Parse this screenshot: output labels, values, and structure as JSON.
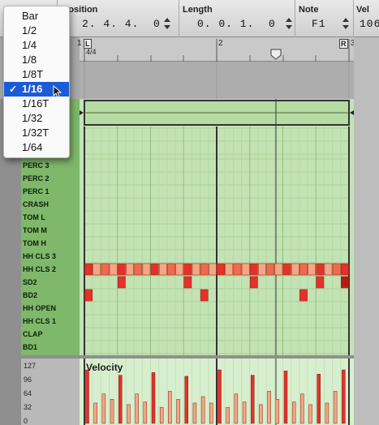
{
  "toolbar": {
    "position_label": "Position",
    "position_value": "2. 4. 4.  0",
    "length_label": "Length",
    "length_value": "0. 0. 1.  0",
    "note_label": "Note",
    "note_value": "F1",
    "vel_label": "Vel",
    "vel_value": "106"
  },
  "ruler": {
    "bar1": "1",
    "bar1_sig": "4/4",
    "bar2": "2",
    "bar3": "3",
    "loop_left_marker": "L",
    "loop_right_marker": "R"
  },
  "quantize_menu": {
    "items": [
      "Bar",
      "1/2",
      "1/4",
      "1/8",
      "1/8T",
      "1/16",
      "1/16T",
      "1/32",
      "1/32T",
      "1/64"
    ],
    "selected": "1/16",
    "check_glyph": "✓"
  },
  "drum_lanes": [
    "PERC 3",
    "PERC 2",
    "PERC 1",
    "CRASH",
    "TOM L",
    "TOM M",
    "TOM H",
    "HH CLS 3",
    "HH CLS 2",
    "SD2",
    "BD2",
    "HH OPEN",
    "HH CLS 1",
    "CLAP",
    "BD1"
  ],
  "velocity_lane": {
    "title": "Velocity",
    "ticks": [
      "127",
      "96",
      "64",
      "32",
      "0"
    ]
  },
  "colors": {
    "grid_bg": "#c3e3b4",
    "lane_label_bg": "#7fb86a",
    "note_strong": "#e5302b",
    "note_light": "#f5a685",
    "selection_blue": "#1c5bd8",
    "selected_note": "#b51a16"
  },
  "notes": {
    "hh_cls_2_steps": [
      {
        "v": 1.0
      },
      {
        "v": 0.5
      },
      {
        "v": 0.6
      },
      {
        "v": 0.5
      },
      {
        "v": 0.95
      },
      {
        "v": 0.5
      },
      {
        "v": 0.6
      },
      {
        "v": 0.5
      },
      {
        "v": 1.0
      },
      {
        "v": 0.5
      },
      {
        "v": 0.6
      },
      {
        "v": 0.5
      },
      {
        "v": 0.95
      },
      {
        "v": 0.5
      },
      {
        "v": 0.6
      },
      {
        "v": 0.5
      },
      {
        "v": 1.0
      },
      {
        "v": 0.5
      },
      {
        "v": 0.6
      },
      {
        "v": 0.5
      },
      {
        "v": 0.95
      },
      {
        "v": 0.5
      },
      {
        "v": 0.6
      },
      {
        "v": 0.5
      },
      {
        "v": 1.0
      },
      {
        "v": 0.5
      },
      {
        "v": 0.6
      },
      {
        "v": 0.5
      },
      {
        "v": 0.95
      },
      {
        "v": 0.5
      },
      {
        "v": 0.6
      },
      {
        "v": 1.0
      }
    ],
    "sd2_steps": [
      4,
      12,
      20,
      28,
      31
    ],
    "bd2_steps": [
      0,
      14,
      26
    ]
  },
  "velocity_bars": [
    {
      "v": 1.0,
      "c": "s"
    },
    {
      "v": 0.38,
      "c": "l"
    },
    {
      "v": 0.55,
      "c": "l"
    },
    {
      "v": 0.45,
      "c": "l"
    },
    {
      "v": 0.9,
      "c": "s"
    },
    {
      "v": 0.35,
      "c": "l"
    },
    {
      "v": 0.55,
      "c": "l"
    },
    {
      "v": 0.4,
      "c": "l"
    },
    {
      "v": 0.95,
      "c": "s"
    },
    {
      "v": 0.3,
      "c": "l"
    },
    {
      "v": 0.6,
      "c": "l"
    },
    {
      "v": 0.45,
      "c": "l"
    },
    {
      "v": 0.88,
      "c": "s"
    },
    {
      "v": 0.38,
      "c": "l"
    },
    {
      "v": 0.5,
      "c": "l"
    },
    {
      "v": 0.38,
      "c": "l"
    },
    {
      "v": 1.0,
      "c": "s"
    },
    {
      "v": 0.3,
      "c": "l"
    },
    {
      "v": 0.55,
      "c": "l"
    },
    {
      "v": 0.4,
      "c": "l"
    },
    {
      "v": 0.9,
      "c": "s"
    },
    {
      "v": 0.35,
      "c": "l"
    },
    {
      "v": 0.6,
      "c": "l"
    },
    {
      "v": 0.45,
      "c": "l"
    },
    {
      "v": 0.98,
      "c": "s"
    },
    {
      "v": 0.4,
      "c": "l"
    },
    {
      "v": 0.55,
      "c": "l"
    },
    {
      "v": 0.35,
      "c": "l"
    },
    {
      "v": 0.92,
      "c": "s"
    },
    {
      "v": 0.38,
      "c": "l"
    },
    {
      "v": 0.6,
      "c": "l"
    },
    {
      "v": 1.0,
      "c": "s"
    }
  ]
}
